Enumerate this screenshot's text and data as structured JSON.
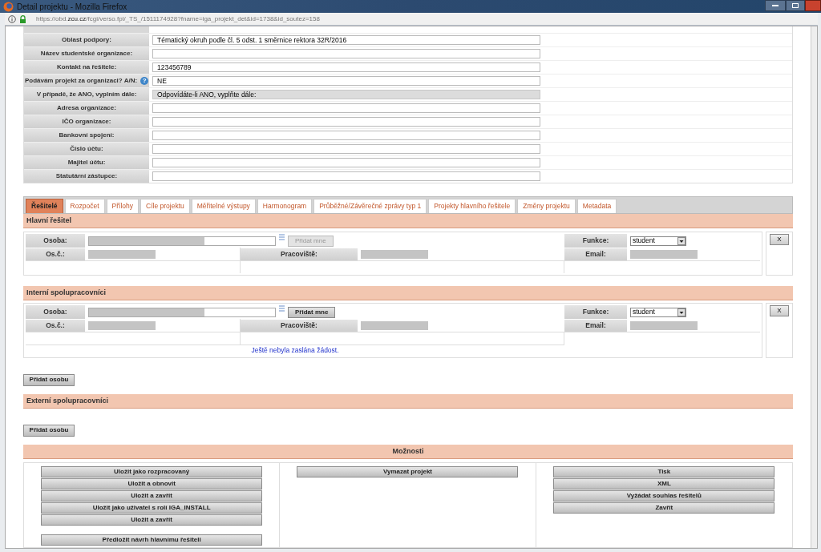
{
  "window": {
    "title": "Detail projektu - Mozilla Firefox"
  },
  "address_bar": {
    "url": "https://obd.**zcu.cz**/fcgi/verso.fpl/_TS_/1511174928?fname=iga_projekt_det&id=1738&id_soutez=158"
  },
  "form": {
    "rows": [
      {
        "label": "Oblast podpory:",
        "kind": "input",
        "value": "Tématický okruh podle čl. 5 odst. 1 směrnice rektora 32R/2016"
      },
      {
        "label": "Název studentské organizace:",
        "kind": "input"
      },
      {
        "label": "Kontakt na řešitele:",
        "kind": "input",
        "value": "123456789"
      },
      {
        "label": "Podávám projekt za organizaci? A/N:",
        "kind": "input",
        "value": "NE",
        "help": "?"
      },
      {
        "label": "V případě, že ANO, vyplním dále:",
        "kind": "readonly",
        "value": "Odpovídáte-li ANO, vyplňte dále:"
      },
      {
        "label": "Adresa organizace:",
        "kind": "input"
      },
      {
        "label": "IČO organizace:",
        "kind": "input"
      },
      {
        "label": "Bankovní spojení:",
        "kind": "input"
      },
      {
        "label": "Číslo účtu:",
        "kind": "input"
      },
      {
        "label": "Majitel účtu:",
        "kind": "input"
      },
      {
        "label": "Statutární zástupce:",
        "kind": "input"
      }
    ]
  },
  "tabs": [
    {
      "label": "Řešitelé",
      "selected": true
    },
    {
      "label": "Rozpočet",
      "selected": false
    },
    {
      "label": "Přílohy",
      "selected": false
    },
    {
      "label": "Cíle projektu",
      "selected": false
    },
    {
      "label": "Měřitelné výstupy",
      "selected": false
    },
    {
      "label": "Harmonogram",
      "selected": false
    },
    {
      "label": "Průběžné/Závěrečné zprávy typ 1",
      "selected": false
    },
    {
      "label": "Projekty hlavního řešitele",
      "selected": false
    },
    {
      "label": "Změny projektu",
      "selected": false
    },
    {
      "label": "Metadata",
      "selected": false
    }
  ],
  "main_investigator": {
    "title": "Hlavní řešitel",
    "person_label": "Osoba:",
    "add_me": {
      "label": "Přidat mne",
      "disabled": true
    },
    "function_label": "Funkce:",
    "function_value": "student",
    "number_label": "Os.č.:",
    "workplace_label": "Pracoviště:",
    "email_label": "Email:",
    "remove": "X"
  },
  "internal": {
    "title": "Interní spolupracovníci",
    "person_label": "Osoba:",
    "add_me": {
      "label": "Přidat mne",
      "disabled": false
    },
    "function_label": "Funkce:",
    "function_value": "student",
    "number_label": "Os.č.:",
    "workplace_label": "Pracoviště:",
    "email_label": "Email:",
    "remove": "X",
    "note": "Ještě nebyla zaslána žádost.",
    "add_button": "Přidat osobu"
  },
  "external": {
    "title": "Externí spolupracovníci",
    "add_button": "Přidat osobu"
  },
  "options": {
    "title": "Možnosti",
    "columns": [
      {
        "buttons": [
          "Uložit jako rozpracovaný",
          "Uložit a obnovit",
          "Uložit a zavřít",
          "Uložit jako uživatel s rolí IGA_INSTALL",
          "Uložit a zavřít"
        ],
        "footer_buttons": [
          "Předložit návrh hlavnímu řešiteli"
        ]
      },
      {
        "buttons": [
          "Vymazat projekt"
        ]
      },
      {
        "buttons": [
          "Tisk",
          "XML",
          "Vyžádat souhlas řešitelů",
          "Zavřít"
        ]
      }
    ]
  }
}
